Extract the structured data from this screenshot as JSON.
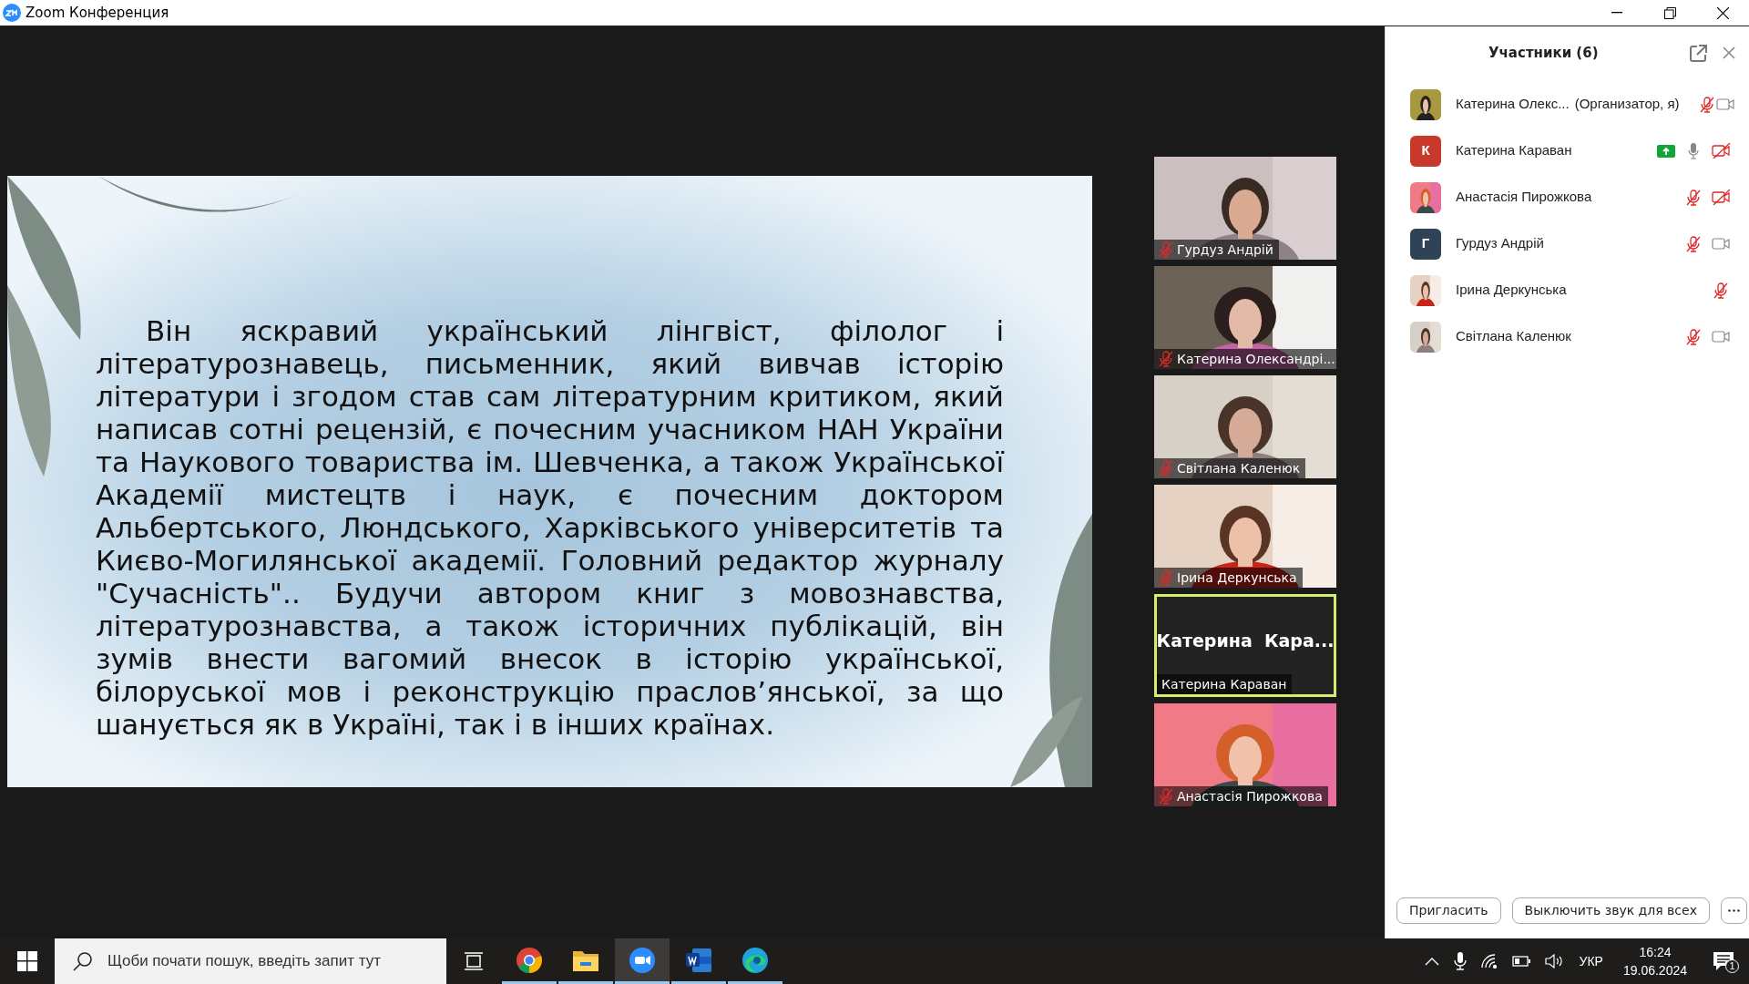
{
  "window": {
    "title": "Zoom Конференция"
  },
  "slide": {
    "text": "Він яскравий український лінгвіст, філолог і літературознавець, письменник, який вивчав історію літератури і згодом став сам літературним критиком, який написав сотні рецензій, є почесним учасником НАН України та Наукового товариства ім. Шевченка, а також Української Академії мистецтв і наук, є почесним доктором Альбертського, Люндського, Харківського університетів та Києво-Могилянської академії. Головний редактор журналу \"Сучасність\".. Будучи автором книг з мовознавства, літературознавства, а також історичних публікацій, він зумів внести вагомий внесок в історію української, білоруської мов і реконструкцію праслов’янської, за що шанується як в Україні, так і в інших країнах."
  },
  "video_tiles": [
    {
      "kind": "video",
      "name": "Гурдуз Андрій",
      "muted": true,
      "active": false
    },
    {
      "kind": "video",
      "name": "Катерина Олександрі...",
      "muted": true,
      "active": false
    },
    {
      "kind": "video",
      "name": "Світлана Каленюк",
      "muted": true,
      "active": false
    },
    {
      "kind": "video",
      "name": "Ірина Деркунська",
      "muted": true,
      "active": false
    },
    {
      "kind": "name",
      "display_name": "Катерина  Кара...",
      "name": "Катерина Караван",
      "muted": false,
      "active": true
    },
    {
      "kind": "video",
      "name": "Анастасія Пирожкова",
      "muted": true,
      "active": false
    }
  ],
  "participants": {
    "title": "Участники (6)",
    "items": [
      {
        "name": "Катерина Олекс...",
        "role": "(Организатор, я)",
        "sharing": false,
        "muted": true,
        "video_off": false
      },
      {
        "kind": "initial",
        "initial": "К",
        "color": "#c8392b",
        "name": "Катерина Караван",
        "sharing": true,
        "muted": false,
        "video_off": true
      },
      {
        "name": "Анастасія Пирожкова",
        "sharing": false,
        "muted": true,
        "video_off": true
      },
      {
        "kind": "initial",
        "initial": "Г",
        "color": "#2f4356",
        "name": "Гурдуз Андрій",
        "sharing": false,
        "muted": true,
        "video_off": false
      },
      {
        "name": "Ірина Деркунська",
        "sharing": false,
        "muted": true
      },
      {
        "name": "Світлана Каленюк",
        "sharing": false,
        "muted": true,
        "video_off": false
      }
    ],
    "buttons": [
      "Пригласить",
      "Выключить звук для всех"
    ]
  },
  "taskbar": {
    "search": {
      "placeholder": "Щоби почати пошук, введіть запит тут"
    },
    "apps": [
      {
        "kind": "chrome",
        "selected": false
      },
      {
        "kind": "files",
        "selected": false
      },
      {
        "kind": "zoom",
        "selected": true
      },
      {
        "kind": "word",
        "selected": false
      },
      {
        "kind": "edge",
        "selected": false
      }
    ],
    "language": "УКР",
    "time": "16:24",
    "date": "19.06.2024",
    "notifications": "1"
  }
}
